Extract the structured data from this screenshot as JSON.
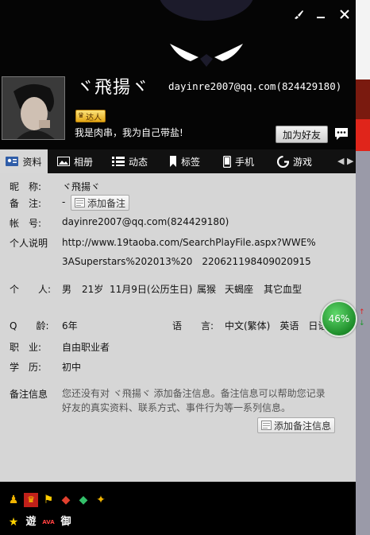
{
  "header": {
    "nickname": "ヾ飛揚ヾ",
    "account": "dayinre2007@qq.com(824429180)",
    "badge_label": "达人",
    "motto": "我是肉串，我为自己带盐!",
    "add_friend_label": "加为好友"
  },
  "tabs": [
    {
      "label": "资料",
      "icon": "profile-card-icon"
    },
    {
      "label": "相册",
      "icon": "photo-icon"
    },
    {
      "label": "动态",
      "icon": "list-icon"
    },
    {
      "label": "标签",
      "icon": "bookmark-icon"
    },
    {
      "label": "手机",
      "icon": "phone-icon"
    },
    {
      "label": "游戏",
      "icon": "game-icon"
    }
  ],
  "profile": {
    "nickname_label": "昵　称:",
    "nickname_value": "ヾ飛揚ヾ",
    "remark_label": "备　注:",
    "remark_value": "-",
    "add_remark_label": "添加备注",
    "account_label": "帐　号:",
    "account_value": "dayinre2007@qq.com(824429180)",
    "bio_label": "个人说明",
    "bio_line1": "http://www.19taoba.com/SearchPlayFile.aspx?WWE%",
    "bio_line2": "3ASuperstars%202013%20　220621198409020915",
    "personal_label": "个　　人:",
    "gender": "男",
    "age": "21岁",
    "birthday": "11月9日(公历生日)",
    "zodiac": "属猴",
    "constellation": "天蝎座",
    "blood_type": "其它血型",
    "qage_label": "Q　　龄:",
    "qage_value": "6年",
    "language_label": "语　　言:",
    "language_value": "中文(繁体)　英语　日语",
    "job_label": "职　业:",
    "job_value": "自由职业者",
    "edu_label": "学　历:",
    "edu_value": "初中",
    "note_label": "备注信息",
    "note_text": "您还没有对 ヾ飛揚ヾ 添加备注信息。备注信息可以帮助您记录好友的真实资料、联系方式、事件行为等一系列信息。",
    "add_note_label": "添加备注信息"
  },
  "progress": {
    "label": "46%",
    "value": 0.46
  },
  "bottom_icons": [
    "figure-icon",
    "mask-icon",
    "flag-icon",
    "diamond-red-icon",
    "diamond-green-icon",
    "gift-icon",
    "star-icon",
    "vip-icon",
    "ava-icon",
    "royal-icon"
  ],
  "bottom_labels": {
    "vip": "遊",
    "ava": "AVA",
    "royal": "御"
  }
}
